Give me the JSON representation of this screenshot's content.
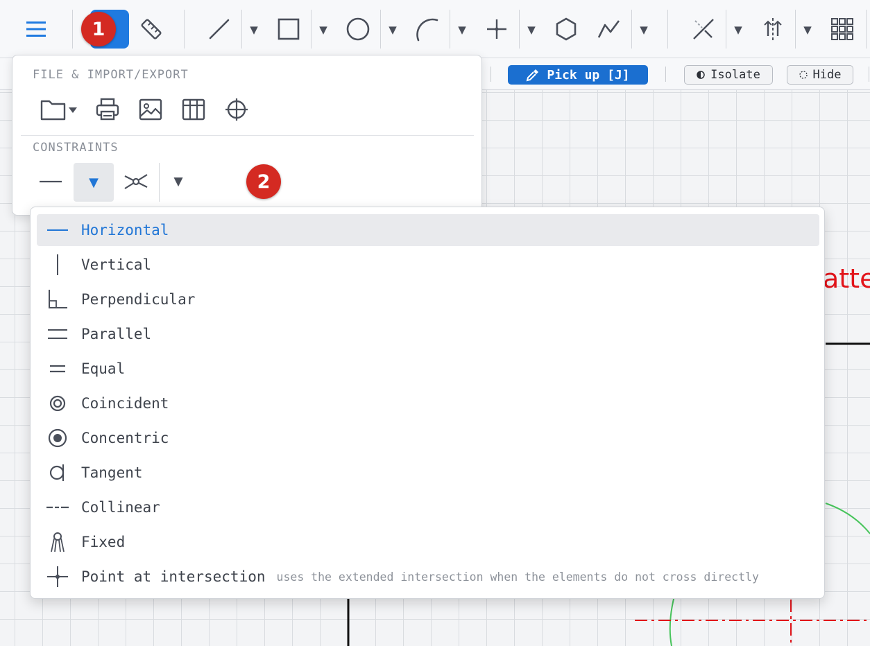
{
  "toolbar": {
    "tools": [
      {
        "name": "menu",
        "icon": "hamburger-icon"
      },
      {
        "name": "active-tool",
        "icon": "active-tool-icon"
      },
      {
        "name": "measure",
        "icon": "ruler-icon"
      },
      {
        "name": "line",
        "icon": "line-icon"
      },
      {
        "name": "rectangle",
        "icon": "rectangle-icon"
      },
      {
        "name": "circle",
        "icon": "circle-icon"
      },
      {
        "name": "arc",
        "icon": "arc-icon"
      },
      {
        "name": "point",
        "icon": "point-icon"
      },
      {
        "name": "polygon",
        "icon": "hexagon-icon"
      },
      {
        "name": "polyline",
        "icon": "polyline-icon"
      },
      {
        "name": "trim",
        "icon": "trim-icon"
      },
      {
        "name": "mirror",
        "icon": "mirror-icon"
      },
      {
        "name": "pattern",
        "icon": "grid-pattern-icon"
      }
    ],
    "accent_color": "#1f7ae0"
  },
  "badges": [
    "1",
    "2"
  ],
  "toolbar2": {
    "pickup_label": "Pick up [J]",
    "isolate_label": "Isolate",
    "hide_label": "Hide"
  },
  "menu_panel": {
    "file_section_title": "FILE & IMPORT/EXPORT",
    "file_icons": [
      "folder-icon",
      "print-icon",
      "image-icon",
      "table-icon",
      "crosshair-icon"
    ],
    "constraints_title": "CONSTRAINTS",
    "constraint_icons": [
      "horizontal-constraint-icon",
      "dropdown-arrow-icon",
      "coincident-cross-icon",
      "dropdown-arrow-icon"
    ]
  },
  "constraints_menu": {
    "items": [
      {
        "label": "Horizontal",
        "icon": "horizontal-icon",
        "selected": true
      },
      {
        "label": "Vertical",
        "icon": "vertical-icon"
      },
      {
        "label": "Perpendicular",
        "icon": "perpendicular-icon"
      },
      {
        "label": "Parallel",
        "icon": "parallel-icon"
      },
      {
        "label": "Equal",
        "icon": "equal-icon"
      },
      {
        "label": "Coincident",
        "icon": "coincident-icon"
      },
      {
        "label": "Concentric",
        "icon": "concentric-icon"
      },
      {
        "label": "Tangent",
        "icon": "tangent-icon"
      },
      {
        "label": "Collinear",
        "icon": "collinear-icon"
      },
      {
        "label": "Fixed",
        "icon": "fixed-icon"
      },
      {
        "label": "Point at intersection",
        "icon": "intersection-point-icon",
        "hint": "uses the extended intersection when the elements do not cross directly"
      }
    ],
    "selected_color": "#2176d6"
  },
  "canvas": {
    "partial_label": "atte",
    "label_color": "#e2141a"
  }
}
